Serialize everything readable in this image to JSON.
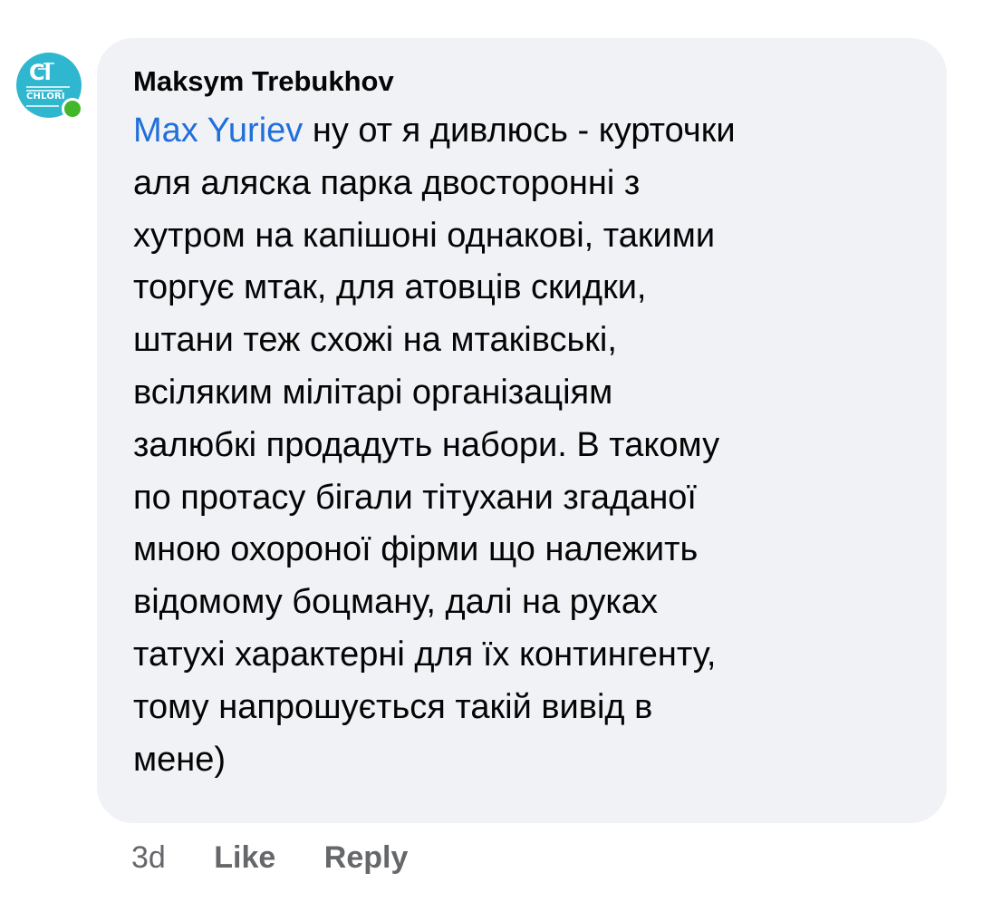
{
  "comment": {
    "avatar": {
      "symbol": "Cl",
      "element_name": "CHLORI",
      "icon": "chlorine-element-avatar",
      "background": "#2fb7cf",
      "online": true,
      "online_color": "#42b72a"
    },
    "author": "Maksym Trebukhov",
    "mention": "Max Yuriev",
    "mention_color": "#216fdb",
    "text_lines": [
      " ну от я дивлюсь - курточки",
      "аля аляска парка двосторонні з",
      "хутром на капішоні однакові, такими",
      "торгує мтак, для атовців скидки,",
      "штани теж схожі на мтаківські,",
      "всіляким мілітарі організаціям",
      "залюбкі продадуть набори. В такому",
      "по протасу бігали тітухани згаданої",
      "мною охороної фірми що належить",
      "відомому боцману, далі на руках",
      "татухі характерні для їх контингенту,",
      "тому напрошується такій вивід в",
      "мене)"
    ],
    "bubble_color": "#f0f2f5"
  },
  "actions": {
    "time": "3d",
    "like": "Like",
    "reply": "Reply"
  }
}
